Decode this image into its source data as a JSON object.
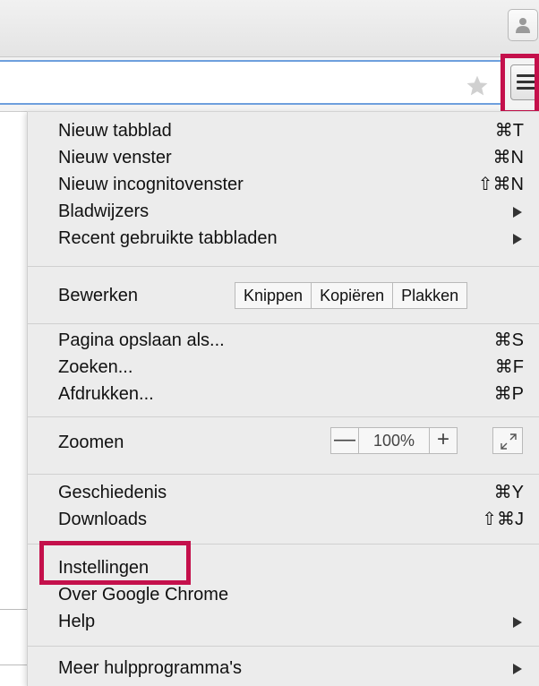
{
  "window": {
    "profile_icon": "person-icon",
    "bookmark_icon": "star-icon",
    "menu_icon": "hamburger-icon"
  },
  "menu": {
    "group1": [
      {
        "label": "Nieuw tabblad",
        "shortcut": "⌘T"
      },
      {
        "label": "Nieuw venster",
        "shortcut": "⌘N"
      },
      {
        "label": "Nieuw incognitovenster",
        "shortcut": "⇧⌘N"
      },
      {
        "label": "Bladwijzers",
        "submenu": true
      },
      {
        "label": "Recent gebruikte tabbladen",
        "submenu": true
      }
    ],
    "edit": {
      "label": "Bewerken",
      "cut": "Knippen",
      "copy": "Kopiëren",
      "paste": "Plakken"
    },
    "group2": [
      {
        "label": "Pagina opslaan als...",
        "shortcut": "⌘S"
      },
      {
        "label": "Zoeken...",
        "shortcut": "⌘F"
      },
      {
        "label": "Afdrukken...",
        "shortcut": "⌘P"
      }
    ],
    "zoom": {
      "label": "Zoomen",
      "minus": "—",
      "level": "100%",
      "plus": "+",
      "fullscreen_icon": "fullscreen-icon"
    },
    "group3": [
      {
        "label": "Geschiedenis",
        "shortcut": "⌘Y"
      },
      {
        "label": "Downloads",
        "shortcut": "⇧⌘J"
      }
    ],
    "group4": [
      {
        "label": "Instellingen"
      },
      {
        "label": "Over Google Chrome"
      },
      {
        "label": "Help",
        "submenu": true
      }
    ],
    "group5": [
      {
        "label": "Meer hulpprogramma's",
        "submenu": true
      }
    ]
  },
  "colors": {
    "highlight": "#c4104b",
    "omnibox_focus": "#6e9fdd",
    "menu_background": "#ececec"
  }
}
